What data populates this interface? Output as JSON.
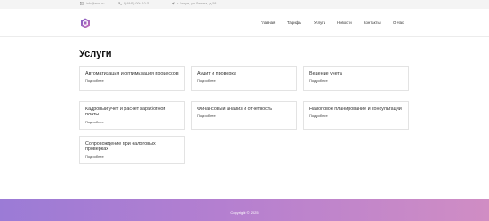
{
  "topbar": {
    "email": "info@ercs.ru",
    "phone": "8(4842) 000-10-01",
    "address": "г. Калуга, ул. Ленина, д. 58"
  },
  "nav": {
    "items": [
      "Главная",
      "Тарифы",
      "Услуги",
      "Новости",
      "Контакты",
      "О Нас"
    ]
  },
  "page": {
    "title": "Услуги"
  },
  "cards": [
    {
      "title": "Автоматизация и оптимизация процессов",
      "more": "Подробнее"
    },
    {
      "title": "Аудит и проверка",
      "more": "Подробнее"
    },
    {
      "title": "Ведение учета",
      "more": "Подробнее"
    },
    {
      "title": "Кадровый учет и расчет заработной платы",
      "more": "Подробнее"
    },
    {
      "title": "Финансовый анализ и отчетность",
      "more": "Подробнее"
    },
    {
      "title": "Налоговое планирование и консультации",
      "more": "Подробнее"
    },
    {
      "title": "Сопровождение при налоговых проверках",
      "more": "Подробнее"
    }
  ],
  "footer": {
    "copyright": "Copyright © 2025"
  },
  "colors": {
    "accent": "#8e6fc8",
    "footer_start": "#9b7bd6",
    "footer_end": "#d08dc4"
  }
}
